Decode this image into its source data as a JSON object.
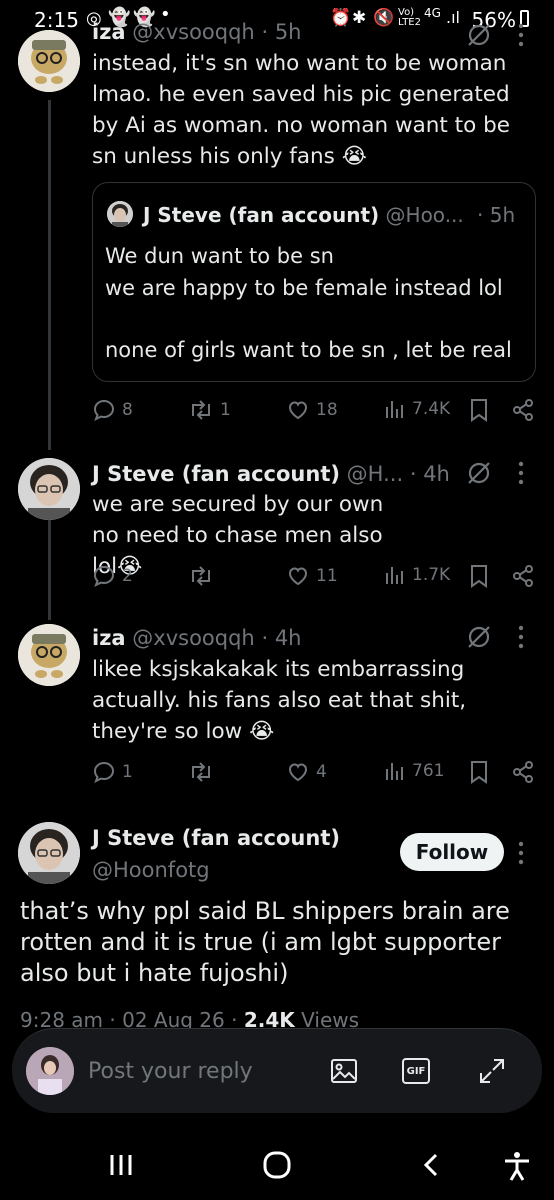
{
  "status_bar": {
    "time": "2:15",
    "battery": "56%",
    "network": "4G"
  },
  "posts": [
    {
      "name": "iza",
      "handle": "@xvsooqqh",
      "dot": "·",
      "time": "5h",
      "text": "instead, it's sn who want to be woman lmao. he even saved his pic generated by Ai as woman. no woman want to be sn unless his only fans 😭",
      "quote": {
        "name": "J Steve (fan account)",
        "handle": "@Hoo...",
        "dot": "·",
        "time": "5h",
        "line1": "We dun want to be sn",
        "line2": "we are happy to be female instead lol",
        "line3": "none of girls want to be sn , let be real"
      },
      "replies": "8",
      "reposts": "1",
      "likes": "18",
      "views": "7.4K"
    },
    {
      "name": "J Steve (fan account)",
      "handle": "@H...",
      "dot": "·",
      "time": "4h",
      "text": "we are secured by our own no need to chase men also lol😭",
      "replies": "2",
      "reposts": "",
      "likes": "11",
      "views": "1.7K"
    },
    {
      "name": "iza",
      "handle": "@xvsooqqh",
      "dot": "·",
      "time": "4h",
      "text": "likee ksjskakakak its embarrassing actually. his fans also eat that shit, they're so low 😭",
      "replies": "1",
      "reposts": "",
      "likes": "4",
      "views": "761"
    }
  ],
  "main_post": {
    "name": "J Steve (fan account)",
    "handle": "@Hoonfotg",
    "follow_label": "Follow",
    "text": "that’s why ppl said BL shippers brain are rotten and it is true (i am lgbt supporter also but i hate fujoshi)",
    "time": "9:28 am",
    "date": "02 Aug 26",
    "views_count": "2.4K",
    "views_label": "Views"
  },
  "reply_bar": {
    "placeholder": "Post your reply",
    "gif_label": "GIF"
  },
  "colors": {
    "background": "#000000",
    "text": "#e7e9ea",
    "muted": "#71767b",
    "follow_bg": "#eff3f4"
  }
}
